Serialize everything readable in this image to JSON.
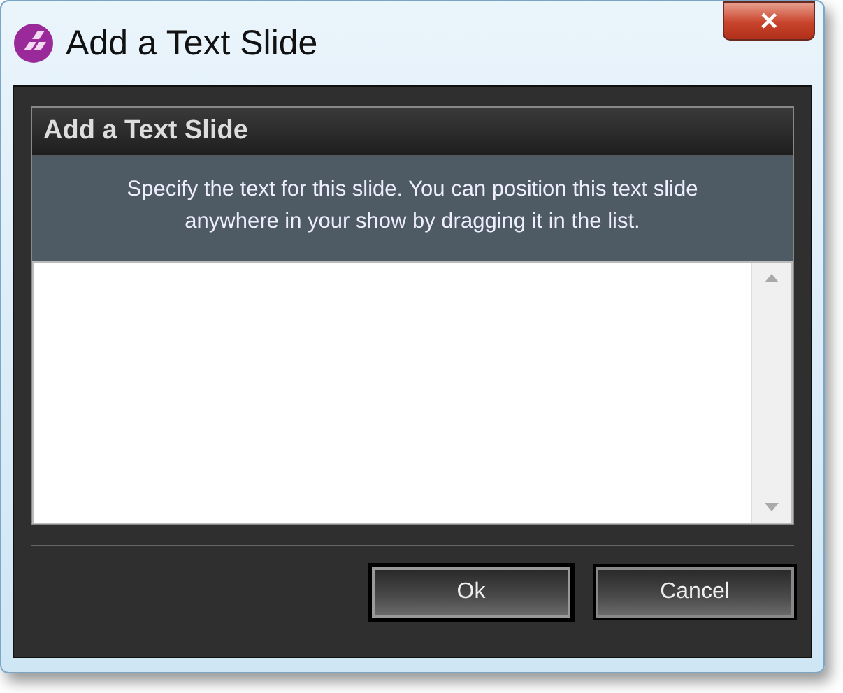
{
  "window": {
    "title": "Add a Text Slide",
    "close": "✕"
  },
  "panel": {
    "heading": "Add a Text Slide",
    "description": "Specify the text for this slide. You can position this text slide anywhere in your show by dragging it in the list."
  },
  "buttons": [
    {
      "label": "Ok",
      "default": true
    },
    {
      "label": "Cancel",
      "default": false
    }
  ]
}
